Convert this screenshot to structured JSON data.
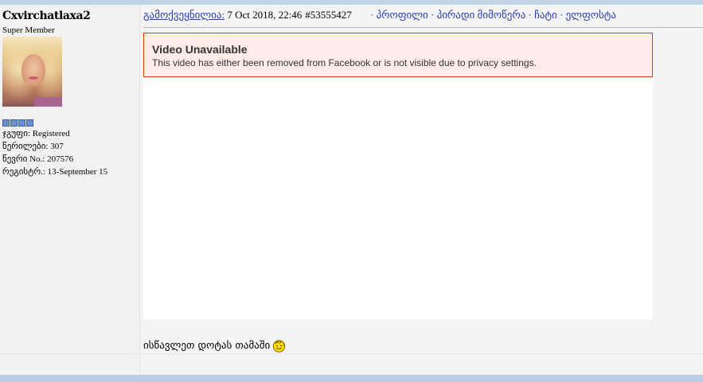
{
  "user": {
    "name": "Cxvirchatlaxa2",
    "rank": "Super Member",
    "rank_boxes": 4,
    "stats": [
      "ჯგუფი: Registered",
      "წერილები: 307",
      "წევრი No.: 207576",
      "რეგისტრ.: 13-September 15"
    ]
  },
  "post": {
    "posted_label": "გამოქვეყნილია:",
    "date": " 7 Oct 2018, 22:46",
    "post_id": "#53555427",
    "links": "· პროფილი · პირადი მიმოწერა · ჩატი · ელფოსტა",
    "text": "ისწავლეთ დოტას თამაში",
    "smiley_icon": "wave-smiley-icon"
  },
  "video": {
    "error_title": "Video Unavailable",
    "error_message": "This video has either been removed from Facebook or is not visible due to privacy settings."
  },
  "colors": {
    "link": "#2a3ea8",
    "error_bg": "#ffebe8",
    "error_border": "#dd3c10",
    "top_bar": "#c3d3e6"
  }
}
